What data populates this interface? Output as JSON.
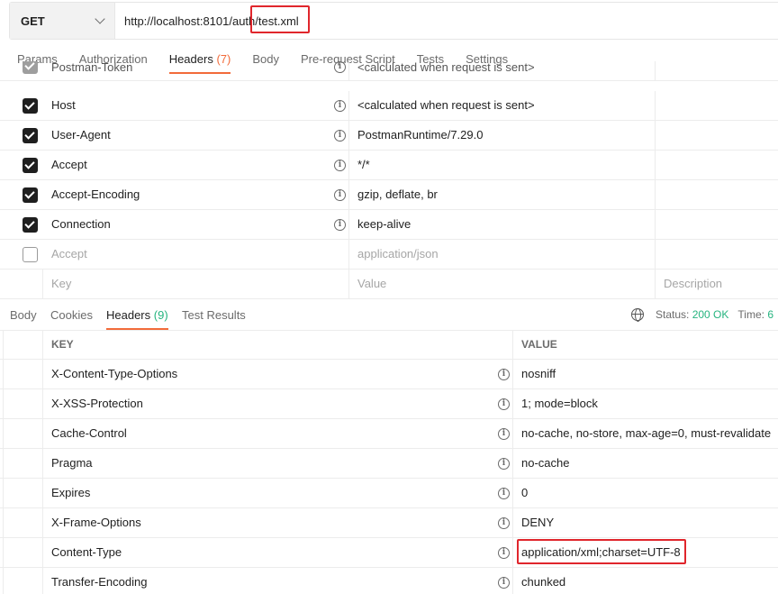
{
  "request": {
    "method": "GET",
    "url": "http://localhost:8101/auth/test.xml"
  },
  "request_tabs": [
    {
      "label": "Params"
    },
    {
      "label": "Authorization"
    },
    {
      "label": "Headers",
      "count": "(7)"
    },
    {
      "label": "Body"
    },
    {
      "label": "Pre-request Script"
    },
    {
      "label": "Tests"
    },
    {
      "label": "Settings"
    }
  ],
  "request_headers": [
    {
      "key": "Postman-Token",
      "value": "<calculated when request is sent>"
    },
    {
      "key": "Host",
      "value": "<calculated when request is sent>"
    },
    {
      "key": "User-Agent",
      "value": "PostmanRuntime/7.29.0"
    },
    {
      "key": "Accept",
      "value": "*/*"
    },
    {
      "key": "Accept-Encoding",
      "value": "gzip, deflate, br"
    },
    {
      "key": "Connection",
      "value": "keep-alive"
    },
    {
      "key": "Accept",
      "value": "application/json"
    }
  ],
  "request_placeholders": {
    "key": "Key",
    "value": "Value",
    "description": "Description"
  },
  "response_tabs": [
    {
      "label": "Body"
    },
    {
      "label": "Cookies"
    },
    {
      "label": "Headers",
      "count": "(9)"
    },
    {
      "label": "Test Results"
    }
  ],
  "response_status": {
    "status_label": "Status:",
    "status_value": "200 OK",
    "time_label": "Time:",
    "time_value": "6"
  },
  "response_columns": {
    "key": "KEY",
    "value": "VALUE"
  },
  "response_headers": [
    {
      "key": "X-Content-Type-Options",
      "value": "nosniff"
    },
    {
      "key": "X-XSS-Protection",
      "value": "1; mode=block"
    },
    {
      "key": "Cache-Control",
      "value": "no-cache, no-store, max-age=0, must-revalidate"
    },
    {
      "key": "Pragma",
      "value": "no-cache"
    },
    {
      "key": "Expires",
      "value": "0"
    },
    {
      "key": "X-Frame-Options",
      "value": "DENY"
    },
    {
      "key": "Content-Type",
      "value": "application/xml;charset=UTF-8"
    },
    {
      "key": "Transfer-Encoding",
      "value": "chunked"
    }
  ],
  "colors": {
    "accent": "#f26b3a",
    "success": "#26b47f",
    "highlight": "#e0262c"
  }
}
